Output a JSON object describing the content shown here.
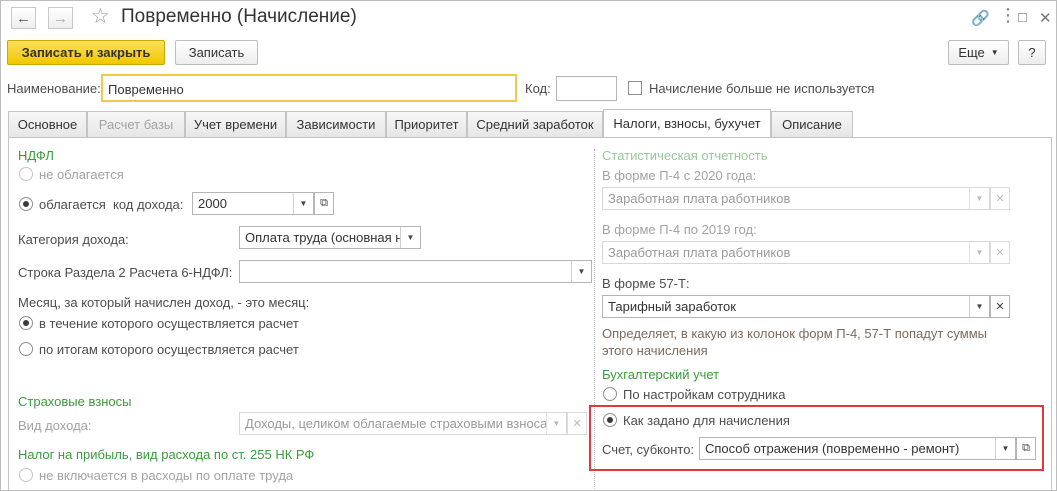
{
  "window": {
    "title": "Повременно (Начисление)"
  },
  "toolbar": {
    "save_close_label": "Записать и закрыть",
    "save_label": "Записать",
    "more_label": "Еще",
    "help_label": "?"
  },
  "header": {
    "name_label": "Наименование:",
    "name_value": "Повременно",
    "code_label": "Код:",
    "code_value": "",
    "not_used_label": "Начисление больше не используется"
  },
  "tabs": [
    {
      "label": "Основное",
      "state": "normal"
    },
    {
      "label": "Расчет базы",
      "state": "disabled"
    },
    {
      "label": "Учет времени",
      "state": "normal"
    },
    {
      "label": "Зависимости",
      "state": "normal"
    },
    {
      "label": "Приоритет",
      "state": "normal"
    },
    {
      "label": "Средний заработок",
      "state": "normal"
    },
    {
      "label": "Налоги, взносы, бухучет",
      "state": "active"
    },
    {
      "label": "Описание",
      "state": "normal"
    }
  ],
  "ndfl": {
    "section_title": "НДФЛ",
    "not_taxed_label": "не облагается",
    "taxed_label": "облагается",
    "income_code_label": "код дохода:",
    "income_code_value": "2000",
    "income_category_label": "Категория дохода:",
    "income_category_value": "Оплата труда (основная н",
    "row_6ndfl_label": "Строка Раздела 2 Расчета 6-НДФЛ:",
    "row_6ndfl_value": "",
    "month_question": "Месяц, за который начислен доход, - это месяц:",
    "month_option1": "в течение которого осуществляется расчет",
    "month_option2": "по итогам которого осуществляется расчет"
  },
  "insurance": {
    "section_title": "Страховые взносы",
    "income_type_label": "Вид дохода:",
    "income_type_value": "Доходы, целиком облагаемые страховыми взносам"
  },
  "profit_tax": {
    "section_title": "Налог на прибыль, вид расхода по ст. 255 НК РФ",
    "option_label": "не включается в расходы по оплате труда"
  },
  "stats": {
    "section_title": "Статистическая отчетность",
    "p4_2020_label": "В форме П-4 с 2020 года:",
    "p4_2020_value": "Заработная плата работников",
    "p4_2019_label": "В форме П-4 по 2019 год:",
    "p4_2019_value": "Заработная плата работников",
    "form57_label": "В форме 57-Т:",
    "form57_value": "Тарифный заработок",
    "hint_line1": "Определяет, в какую из колонок форм П-4, 57-Т попадут суммы",
    "hint_line2": "этого начисления"
  },
  "accounting": {
    "section_title": "Бухгалтерский учет",
    "option_employee": "По настройкам сотрудника",
    "option_accrual": "Как задано для начисления",
    "account_label": "Счет, субконто:",
    "account_value": "Способ отражения (повременно - ремонт)"
  },
  "colors": {
    "section_green": "#3c9b3c",
    "primary_button": "#f1c700",
    "highlight_border": "#e2373f",
    "hint_text": "#7d6a5a"
  }
}
